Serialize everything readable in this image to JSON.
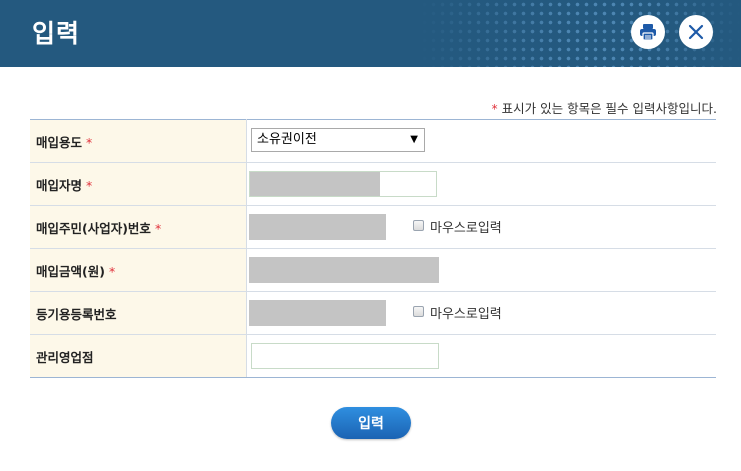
{
  "window": {
    "title": "입력",
    "print_icon": "print-icon",
    "close_icon": "close-icon",
    "header_color": "#24597f"
  },
  "notice": {
    "marker": "*",
    "text": "표시가 있는 항목은 필수 입력사항입니다."
  },
  "form": {
    "rows": [
      {
        "label": "매입용도",
        "required": "*",
        "type": "select",
        "value": "소유권이전"
      },
      {
        "label": "매입자명",
        "required": "*",
        "type": "text",
        "value": ""
      },
      {
        "label": "매입주민(사업자)번호",
        "required": "*",
        "type": "text",
        "value": "",
        "checkbox_label": "마우스로입력"
      },
      {
        "label": "매입금액(원)",
        "required": "*",
        "type": "text",
        "value": ""
      },
      {
        "label": "등기용등록번호",
        "required": "",
        "type": "text",
        "value": "",
        "checkbox_label": "마우스로입력"
      },
      {
        "label": "관리영업점",
        "required": "",
        "type": "text",
        "value": ""
      }
    ],
    "select_arrow": "▼"
  },
  "submit_label": "입력",
  "colors": {
    "label_bg": "#fdf8e9",
    "required_marker": "#e0303a",
    "button": "#1f74c8"
  }
}
